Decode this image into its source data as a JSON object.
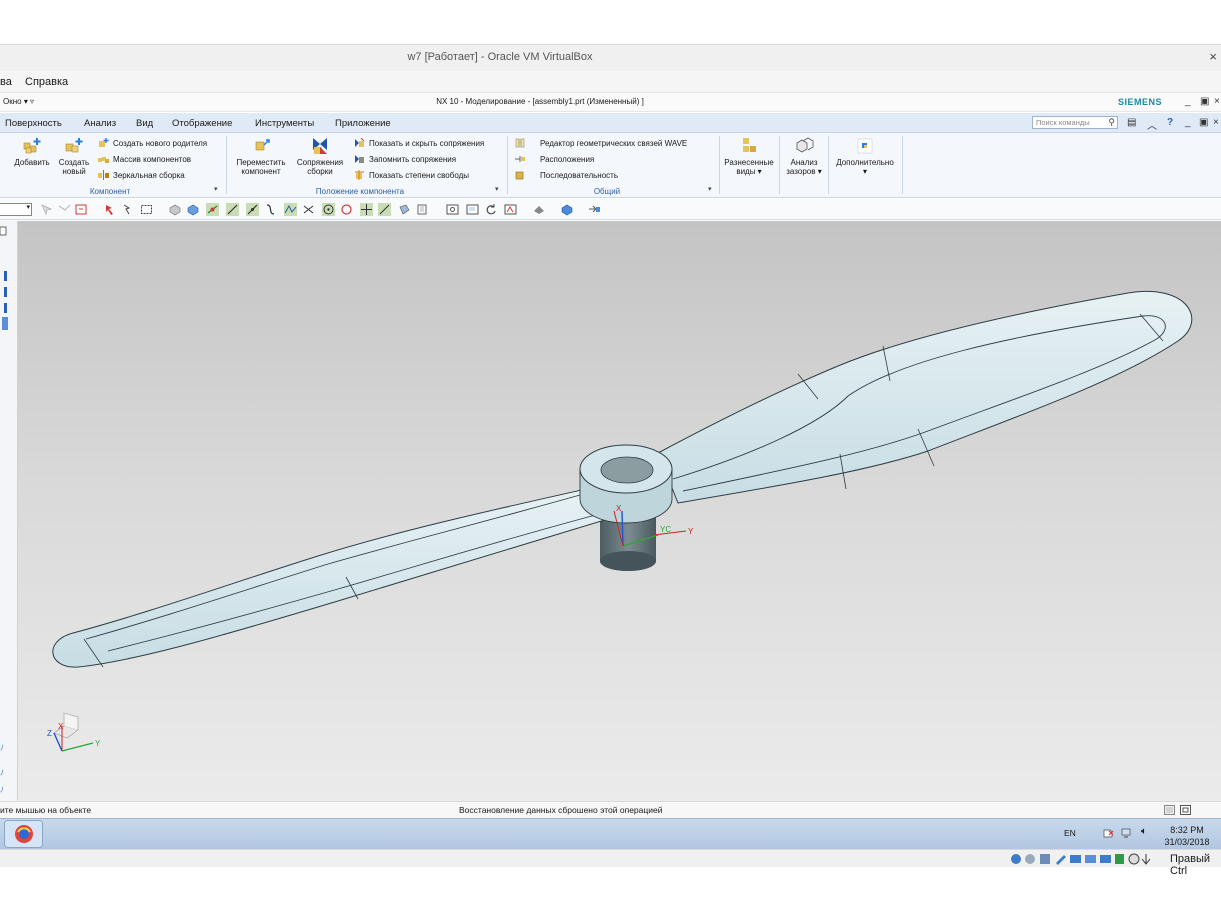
{
  "vbox": {
    "title": "w7 [Работает] - Oracle VM VirtualBox",
    "menu": [
      "ва",
      "Справка"
    ],
    "host_key_label": "Правый Ctrl"
  },
  "nx": {
    "window_menu": "Окно ▾ ▿",
    "caption": "NX 10 - Моделирование - [assembly1.prt (Измененный) ]",
    "brand": "SIEMENS",
    "menu": [
      "Поверхность",
      "Анализ",
      "Вид",
      "Отображение",
      "Инструменты",
      "Приложение"
    ],
    "search_placeholder": "Поиск команды"
  },
  "ribbon": {
    "component": {
      "add": "Добавить",
      "create_new_1": "Создать",
      "create_new_2": "новый",
      "create_parent": "Создать нового родителя",
      "pattern": "Массив компонентов",
      "mirror": "Зеркальная сборка",
      "group": "Компонент"
    },
    "position": {
      "move_1": "Переместить",
      "move_2": "компонент",
      "constraints_1": "Сопряжения",
      "constraints_2": "сборки",
      "show_hide": "Показать и скрыть сопряжения",
      "remember": "Запомнить сопряжения",
      "dof": "Показать степени свободы",
      "group": "Положение компонента"
    },
    "general": {
      "wave": "Редактор геометрических связей WAVE",
      "arrangements": "Расположения",
      "sequence": "Последовательность",
      "group": "Общий"
    },
    "exploded_1": "Разнесенные",
    "exploded_2": "виды ▾",
    "clearance_1": "Анализ",
    "clearance_2": "зазоров ▾",
    "more": "Дополнительно"
  },
  "viewport": {
    "wcs_x": "X",
    "wcs_y": "Y",
    "wcs_xc": "XC",
    "wcs_yc": "YC",
    "triad_x": "X",
    "triad_y": "Y",
    "triad_z": "Z"
  },
  "status": {
    "prompt": "ите мышью на объекте",
    "message": "Восстановление данных сброшено этой операцией"
  },
  "taskbar": {
    "lang": "EN",
    "time": "8:32 PM",
    "date": "31/03/2018"
  },
  "colors": {
    "model_fill": "#d8e9ee",
    "hub_dark": "#5c6d72",
    "ribbon_group": "#2d5fa8",
    "brand": "#1a8aa6"
  }
}
